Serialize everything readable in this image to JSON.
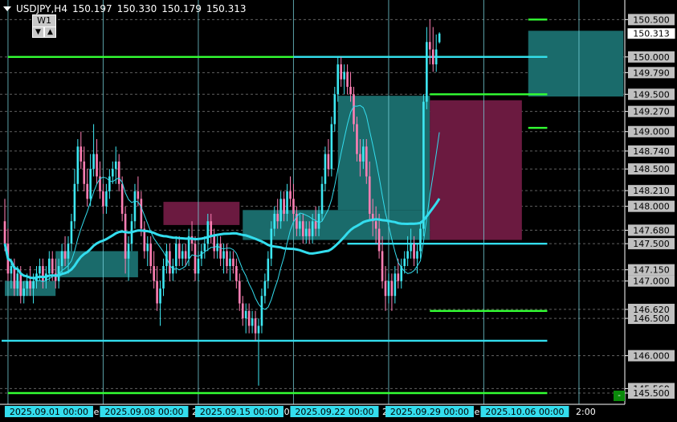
{
  "header": {
    "symbol_tf": "USDJPY,H4",
    "open": "150.197",
    "high": "150.330",
    "low": "150.179",
    "close": "150.313"
  },
  "timeframe_box": {
    "label": "W1",
    "down": "▼",
    "up": "▲"
  },
  "axis_minus": "-",
  "chart_data": {
    "type": "candlestick",
    "symbol": "USDJPY",
    "timeframe": "H4",
    "ylim": [
      145.5,
      150.62
    ],
    "y_ticks": [
      "150.500",
      "150.000",
      "149.790",
      "149.500",
      "149.270",
      "149.000",
      "148.740",
      "148.500",
      "148.210",
      "148.000",
      "147.680",
      "147.500",
      "147.150",
      "147.000",
      "146.620",
      "146.500",
      "146.000",
      "145.560",
      "145.500"
    ],
    "current_price": "150.313",
    "x_labels": [
      {
        "idx": 1,
        "text": "2025.09.01 00:00"
      },
      {
        "idx": 31,
        "text": "2025.09.08 00:00"
      },
      {
        "idx": 61,
        "text": "2025.09.15 00:00"
      },
      {
        "idx": 91,
        "text": "2025.09.22 00:00"
      },
      {
        "idx": 121,
        "text": "2025.09.29 00:00"
      },
      {
        "idx": 151,
        "text": "2025.10.06 00:00"
      }
    ],
    "x_fragments": [
      {
        "idx": 0,
        "text": "2"
      },
      {
        "idx": 28,
        "text": "e"
      },
      {
        "idx": 59,
        "text": "2"
      },
      {
        "idx": 88,
        "text": "0"
      },
      {
        "idx": 119,
        "text": "2"
      },
      {
        "idx": 148,
        "text": "e"
      },
      {
        "idx": 180,
        "text": "2:00"
      }
    ],
    "period_separators": [
      1,
      31,
      61,
      91,
      121,
      151,
      181
    ],
    "horizontal_levels": [
      {
        "price": 150.0,
        "from": 1,
        "to": 171,
        "color": "#33ff33"
      },
      {
        "price": 150.0,
        "from": 91,
        "to": 171,
        "color": "#33ddee"
      },
      {
        "price": 149.5,
        "from": 134,
        "to": 171,
        "color": "#33ff33"
      },
      {
        "price": 147.5,
        "from": 108,
        "to": 171,
        "color": "#33ddee"
      },
      {
        "price": 146.6,
        "from": 134,
        "to": 171,
        "color": "#33ff33"
      },
      {
        "price": 146.2,
        "from": -1,
        "to": 171,
        "color": "#33ddee"
      },
      {
        "price": 145.5,
        "from": 1,
        "to": 171,
        "color": "#33ff33"
      },
      {
        "price": 150.5,
        "from": 165,
        "to": 171,
        "color": "#33ff33"
      },
      {
        "price": 149.05,
        "from": 165,
        "to": 171,
        "color": "#33ff33"
      }
    ],
    "zones": [
      {
        "from": 0,
        "to": 16,
        "low": 146.8,
        "high": 147.0,
        "color": "#1a6b6b"
      },
      {
        "from": 16,
        "to": 42,
        "low": 147.05,
        "high": 147.4,
        "color": "#1a6b6b"
      },
      {
        "from": 50,
        "to": 74,
        "low": 147.75,
        "high": 148.06,
        "color": "#6b1a40"
      },
      {
        "from": 75,
        "to": 134,
        "low": 147.55,
        "high": 147.95,
        "color": "#1a6b6b"
      },
      {
        "from": 105,
        "to": 134,
        "low": 147.95,
        "high": 149.48,
        "color": "#1a6b6b"
      },
      {
        "from": 134,
        "to": 163,
        "low": 147.55,
        "high": 149.42,
        "color": "#6b1a40"
      },
      {
        "from": 165,
        "to": 195,
        "low": 149.47,
        "high": 150.35,
        "color": "#1a6b6b"
      }
    ],
    "candles": [
      [
        147.8,
        148.1,
        147.4,
        147.5
      ],
      [
        147.5,
        147.7,
        147.0,
        147.1
      ],
      [
        147.1,
        147.3,
        146.9,
        147.2
      ],
      [
        147.2,
        147.3,
        146.8,
        146.9
      ],
      [
        146.9,
        147.2,
        146.8,
        147.1
      ],
      [
        147.1,
        147.2,
        146.7,
        146.8
      ],
      [
        146.8,
        147.0,
        146.7,
        146.9
      ],
      [
        146.9,
        147.1,
        146.8,
        147.0
      ],
      [
        147.0,
        147.2,
        146.8,
        146.9
      ],
      [
        146.9,
        147.1,
        146.7,
        147.0
      ],
      [
        147.0,
        147.2,
        146.9,
        147.1
      ],
      [
        147.1,
        147.3,
        147.0,
        147.2
      ],
      [
        147.2,
        147.3,
        146.9,
        147.0
      ],
      [
        147.0,
        147.2,
        146.9,
        147.1
      ],
      [
        147.1,
        147.4,
        147.0,
        147.3
      ],
      [
        147.3,
        147.4,
        147.0,
        147.1
      ],
      [
        147.1,
        147.3,
        146.9,
        147.0
      ],
      [
        147.0,
        147.3,
        146.9,
        147.2
      ],
      [
        147.2,
        147.5,
        147.1,
        147.4
      ],
      [
        147.4,
        147.6,
        147.2,
        147.3
      ],
      [
        147.3,
        147.6,
        147.1,
        147.5
      ],
      [
        147.5,
        147.9,
        147.4,
        147.8
      ],
      [
        147.8,
        148.5,
        147.7,
        148.3
      ],
      [
        148.3,
        148.9,
        148.2,
        148.8
      ],
      [
        148.8,
        149.0,
        148.5,
        148.6
      ],
      [
        148.6,
        148.8,
        148.2,
        148.3
      ],
      [
        148.3,
        148.5,
        148.0,
        148.1
      ],
      [
        148.1,
        148.7,
        148.0,
        148.5
      ],
      [
        148.5,
        149.1,
        148.4,
        148.7
      ],
      [
        148.7,
        148.9,
        148.3,
        148.4
      ],
      [
        148.4,
        148.6,
        148.1,
        148.2
      ],
      [
        148.2,
        148.3,
        147.9,
        148.0
      ],
      [
        148.0,
        148.3,
        147.9,
        148.2
      ],
      [
        148.2,
        148.5,
        148.1,
        148.4
      ],
      [
        148.4,
        148.6,
        148.3,
        148.5
      ],
      [
        148.5,
        148.8,
        148.3,
        148.6
      ],
      [
        148.6,
        148.7,
        148.2,
        148.3
      ],
      [
        148.3,
        148.4,
        147.8,
        147.9
      ],
      [
        147.9,
        148.0,
        147.1,
        147.3
      ],
      [
        147.3,
        147.6,
        147.0,
        147.5
      ],
      [
        147.5,
        147.9,
        147.4,
        147.8
      ],
      [
        147.8,
        148.3,
        147.7,
        148.2
      ],
      [
        148.2,
        148.4,
        148.0,
        148.1
      ],
      [
        148.1,
        148.2,
        147.6,
        147.7
      ],
      [
        147.7,
        147.8,
        147.3,
        147.4
      ],
      [
        147.4,
        147.6,
        147.2,
        147.5
      ],
      [
        147.5,
        147.6,
        147.1,
        147.2
      ],
      [
        147.2,
        147.4,
        146.9,
        147.0
      ],
      [
        147.0,
        147.2,
        146.6,
        146.7
      ],
      [
        146.7,
        147.0,
        146.4,
        146.9
      ],
      [
        146.9,
        147.3,
        146.8,
        147.2
      ],
      [
        147.2,
        147.5,
        147.1,
        147.4
      ],
      [
        147.4,
        147.5,
        147.0,
        147.1
      ],
      [
        147.1,
        147.3,
        147.0,
        147.2
      ],
      [
        147.2,
        147.6,
        147.1,
        147.5
      ],
      [
        147.5,
        147.6,
        147.2,
        147.3
      ],
      [
        147.3,
        147.5,
        147.2,
        147.4
      ],
      [
        147.4,
        147.5,
        147.2,
        147.3
      ],
      [
        147.3,
        147.7,
        147.2,
        147.6
      ],
      [
        147.6,
        147.8,
        147.4,
        147.5
      ],
      [
        147.5,
        147.6,
        147.0,
        147.1
      ],
      [
        147.1,
        147.4,
        147.0,
        147.3
      ],
      [
        147.3,
        147.5,
        147.2,
        147.4
      ],
      [
        147.4,
        147.6,
        147.3,
        147.5
      ],
      [
        147.5,
        147.9,
        147.4,
        147.8
      ],
      [
        147.8,
        147.9,
        147.5,
        147.6
      ],
      [
        147.6,
        147.7,
        147.3,
        147.4
      ],
      [
        147.4,
        147.6,
        147.3,
        147.5
      ],
      [
        147.5,
        147.6,
        147.2,
        147.3
      ],
      [
        147.3,
        147.5,
        147.1,
        147.4
      ],
      [
        147.4,
        147.5,
        147.1,
        147.2
      ],
      [
        147.2,
        147.4,
        147.0,
        147.3
      ],
      [
        147.3,
        147.4,
        147.1,
        147.2
      ],
      [
        147.2,
        147.3,
        146.9,
        147.0
      ],
      [
        147.0,
        147.1,
        146.6,
        146.7
      ],
      [
        146.7,
        146.8,
        146.4,
        146.5
      ],
      [
        146.5,
        146.7,
        146.3,
        146.6
      ],
      [
        146.6,
        146.7,
        146.3,
        146.4
      ],
      [
        146.4,
        146.6,
        146.3,
        146.5
      ],
      [
        146.5,
        146.6,
        146.2,
        146.3
      ],
      [
        146.3,
        146.5,
        145.6,
        146.4
      ],
      [
        146.4,
        146.9,
        146.3,
        146.8
      ],
      [
        146.8,
        147.1,
        146.7,
        147.0
      ],
      [
        147.0,
        147.4,
        146.9,
        147.3
      ],
      [
        147.3,
        147.8,
        147.2,
        147.7
      ],
      [
        147.7,
        148.0,
        147.6,
        147.9
      ],
      [
        147.9,
        148.1,
        147.7,
        147.8
      ],
      [
        147.8,
        148.2,
        147.7,
        148.1
      ],
      [
        148.1,
        148.2,
        147.8,
        147.9
      ],
      [
        147.9,
        148.3,
        147.8,
        148.2
      ],
      [
        148.2,
        148.4,
        148.0,
        148.1
      ],
      [
        148.1,
        148.3,
        147.8,
        147.9
      ],
      [
        147.9,
        148.0,
        147.6,
        147.7
      ],
      [
        147.7,
        147.9,
        147.6,
        147.8
      ],
      [
        147.8,
        147.9,
        147.5,
        147.6
      ],
      [
        147.6,
        147.8,
        147.5,
        147.7
      ],
      [
        147.7,
        147.8,
        147.5,
        147.6
      ],
      [
        147.6,
        147.9,
        147.5,
        147.8
      ],
      [
        147.8,
        148.0,
        147.6,
        147.7
      ],
      [
        147.7,
        148.0,
        147.6,
        147.9
      ],
      [
        147.9,
        148.4,
        147.8,
        148.3
      ],
      [
        148.3,
        148.8,
        148.2,
        148.7
      ],
      [
        148.7,
        148.9,
        148.4,
        148.5
      ],
      [
        148.5,
        149.2,
        148.4,
        149.1
      ],
      [
        149.1,
        149.6,
        149.0,
        149.5
      ],
      [
        149.5,
        150.0,
        149.4,
        149.9
      ],
      [
        149.9,
        150.0,
        149.6,
        149.7
      ],
      [
        149.7,
        149.9,
        149.5,
        149.8
      ],
      [
        149.8,
        149.9,
        149.5,
        149.6
      ],
      [
        149.6,
        149.8,
        149.4,
        149.5
      ],
      [
        149.5,
        149.6,
        149.0,
        149.1
      ],
      [
        149.1,
        149.2,
        148.6,
        148.7
      ],
      [
        148.7,
        148.9,
        148.4,
        148.6
      ],
      [
        148.6,
        148.9,
        148.5,
        148.8
      ],
      [
        148.8,
        148.9,
        148.3,
        148.4
      ],
      [
        148.4,
        148.6,
        147.8,
        147.9
      ],
      [
        147.9,
        148.1,
        147.6,
        147.8
      ],
      [
        147.8,
        148.0,
        147.5,
        147.7
      ],
      [
        147.7,
        147.9,
        147.3,
        147.4
      ],
      [
        147.4,
        147.6,
        146.9,
        147.0
      ],
      [
        147.0,
        147.2,
        146.6,
        146.8
      ],
      [
        146.8,
        147.1,
        146.7,
        147.0
      ],
      [
        147.0,
        147.1,
        146.6,
        146.8
      ],
      [
        146.8,
        147.2,
        146.7,
        147.1
      ],
      [
        147.1,
        147.3,
        146.9,
        147.0
      ],
      [
        147.0,
        147.3,
        146.9,
        147.2
      ],
      [
        147.2,
        147.4,
        147.1,
        147.3
      ],
      [
        147.3,
        147.6,
        147.2,
        147.4
      ],
      [
        147.4,
        147.7,
        147.3,
        147.5
      ],
      [
        147.5,
        147.6,
        147.2,
        147.3
      ],
      [
        147.3,
        147.5,
        147.1,
        147.4
      ],
      [
        147.4,
        147.8,
        147.3,
        147.7
      ],
      [
        147.7,
        149.5,
        147.6,
        149.4
      ],
      [
        149.4,
        150.4,
        149.3,
        150.2
      ],
      [
        150.2,
        150.5,
        149.9,
        150.1
      ],
      [
        150.1,
        150.4,
        149.8,
        149.9
      ],
      [
        149.9,
        150.3,
        149.8,
        150.1
      ],
      [
        150.197,
        150.33,
        150.179,
        150.313
      ]
    ],
    "ma_fast_color": "#33ddee",
    "ma_slow_color": "#33ddee"
  }
}
